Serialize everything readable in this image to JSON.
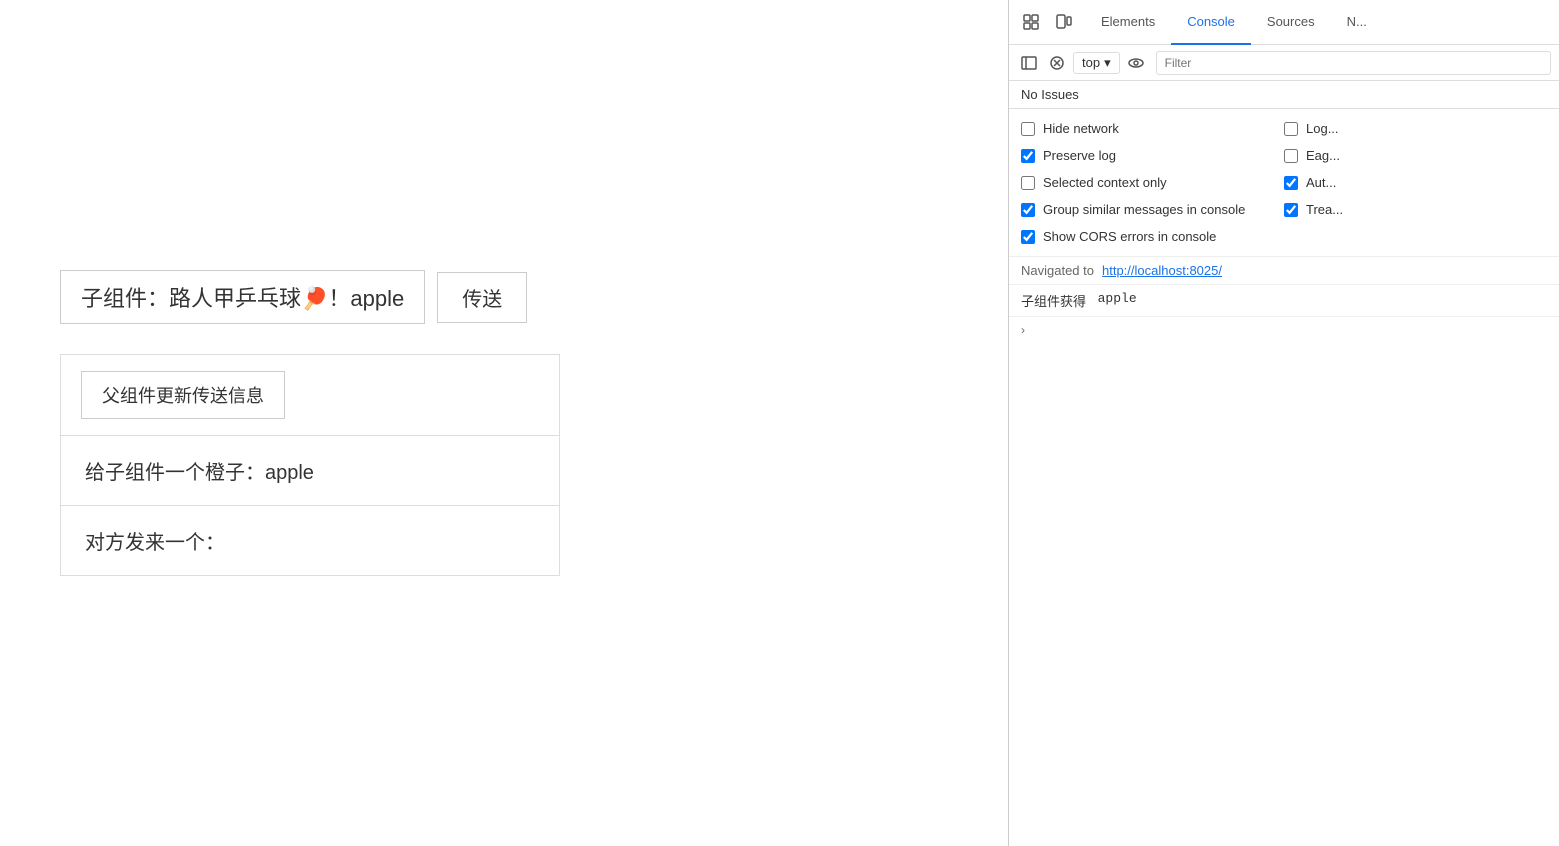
{
  "page": {
    "child_component_label": "子组件：路人甲乒乓球",
    "child_component_emoji": "🏓",
    "child_component_value": "！apple",
    "send_button_label": "传送",
    "parent_update_button_label": "父组件更新传送信息",
    "orange_label": "给子组件一个橙子：apple",
    "received_label": "对方发来一个："
  },
  "devtools": {
    "tabs": [
      {
        "id": "elements",
        "label": "Elements",
        "active": false
      },
      {
        "id": "console",
        "label": "Console",
        "active": true
      },
      {
        "id": "sources",
        "label": "Sources",
        "active": false
      },
      {
        "id": "network",
        "label": "N...",
        "active": false
      }
    ],
    "top_selector": "top",
    "filter_placeholder": "Filter",
    "issues_label": "No Issues",
    "checkboxes": [
      {
        "id": "hide-network",
        "label": "Hide network",
        "checked": false,
        "col": 1
      },
      {
        "id": "log-xhr",
        "label": "Log...",
        "checked": false,
        "col": 2
      },
      {
        "id": "preserve-log",
        "label": "Preserve log",
        "checked": true,
        "col": 1
      },
      {
        "id": "eager",
        "label": "Eag...",
        "checked": false,
        "col": 2
      },
      {
        "id": "selected-context",
        "label": "Selected context only",
        "checked": false,
        "col": 1
      },
      {
        "id": "aut",
        "label": "Aut...",
        "checked": true,
        "col": 2
      },
      {
        "id": "group-similar",
        "label": "Group similar messages in console",
        "checked": true,
        "col": 1
      },
      {
        "id": "trea",
        "label": "Trea...",
        "checked": true,
        "col": 2
      },
      {
        "id": "show-cors",
        "label": "Show CORS errors in console",
        "checked": true,
        "col": 1
      }
    ],
    "console_logs": [
      {
        "type": "navigated",
        "text": "Navigated to ",
        "link": "http://localhost:8025/",
        "link_url": "http://localhost:8025/"
      },
      {
        "type": "log",
        "prefix": "子组件获得",
        "code": "apple"
      }
    ],
    "prompt_chevron": ">"
  }
}
